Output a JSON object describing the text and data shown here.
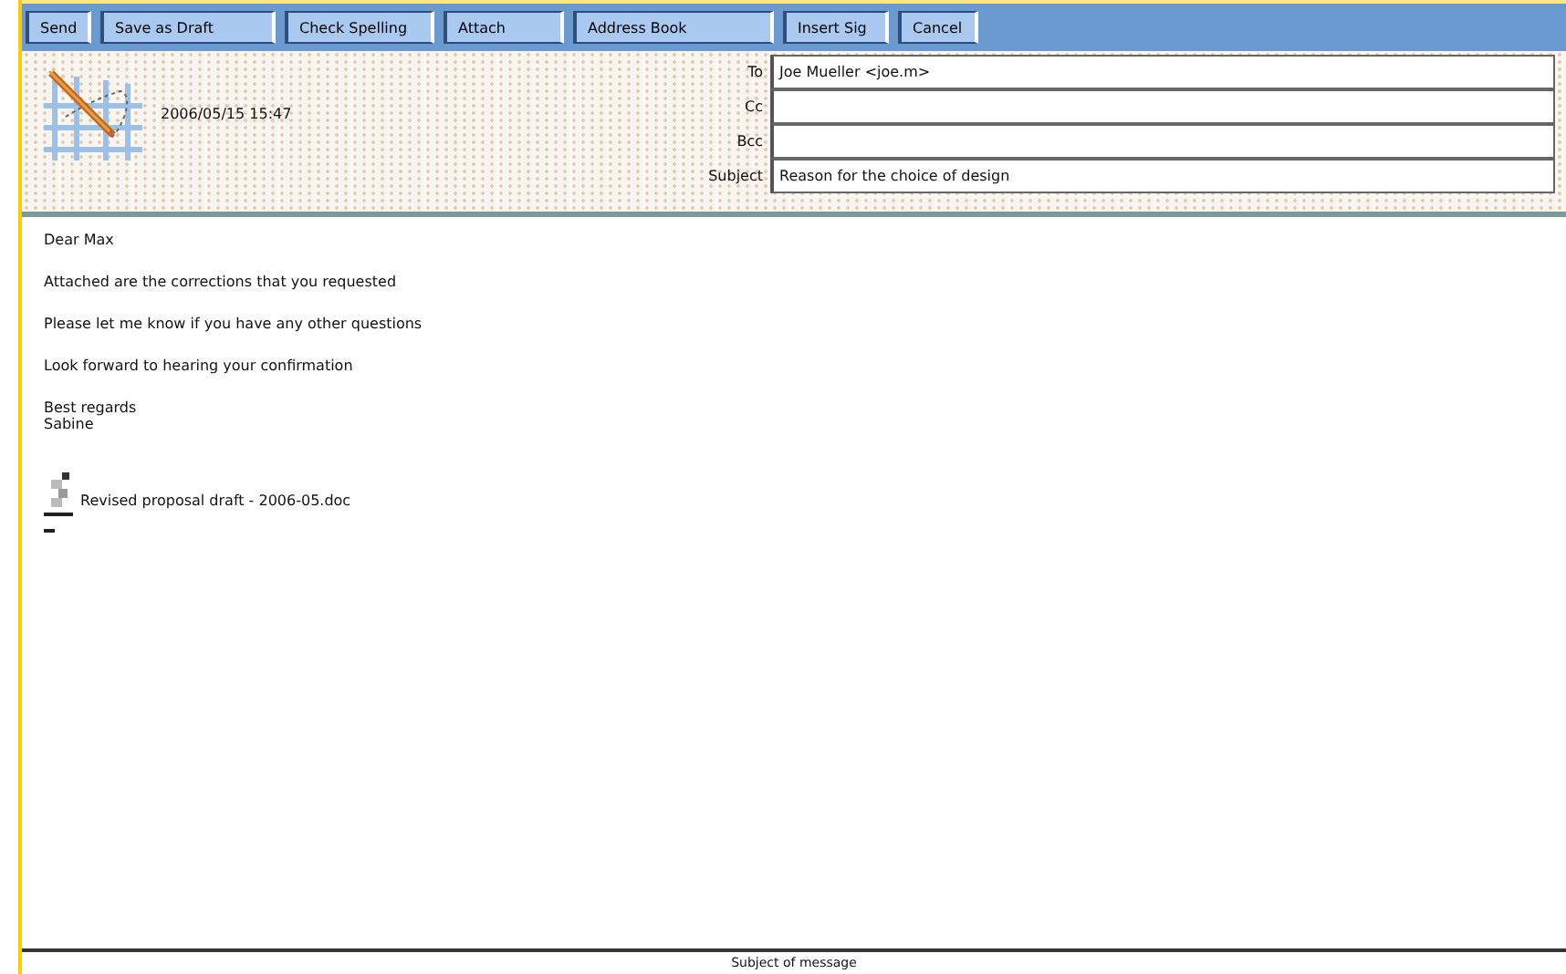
{
  "toolbar": [
    {
      "label": "Send"
    },
    {
      "label": "Save as Draft"
    },
    {
      "label": "Check Spelling"
    },
    {
      "label": "Attach"
    },
    {
      "label": "Address Book"
    },
    {
      "label": "Insert Sig"
    },
    {
      "label": "Cancel"
    }
  ],
  "header": {
    "date": "2006/05/15 15:47",
    "fields": [
      {
        "label": "To",
        "value": "Joe Mueller <joe.m>"
      },
      {
        "label": "Cc"
      },
      {
        "label": "Bcc"
      },
      {
        "label": "Subject",
        "value": "Reason for the choice of design"
      }
    ]
  },
  "body": [
    "Dear Max",
    "Attached are the corrections that you requested",
    "Please let me know if you have any other questions",
    "Look forward to hearing your confirmation"
  ],
  "signature": [
    "Best regards",
    "Sabine"
  ],
  "attachment": {
    "name": "Revised proposal draft - 2006-05.doc"
  },
  "status_bar": "Subject of message"
}
